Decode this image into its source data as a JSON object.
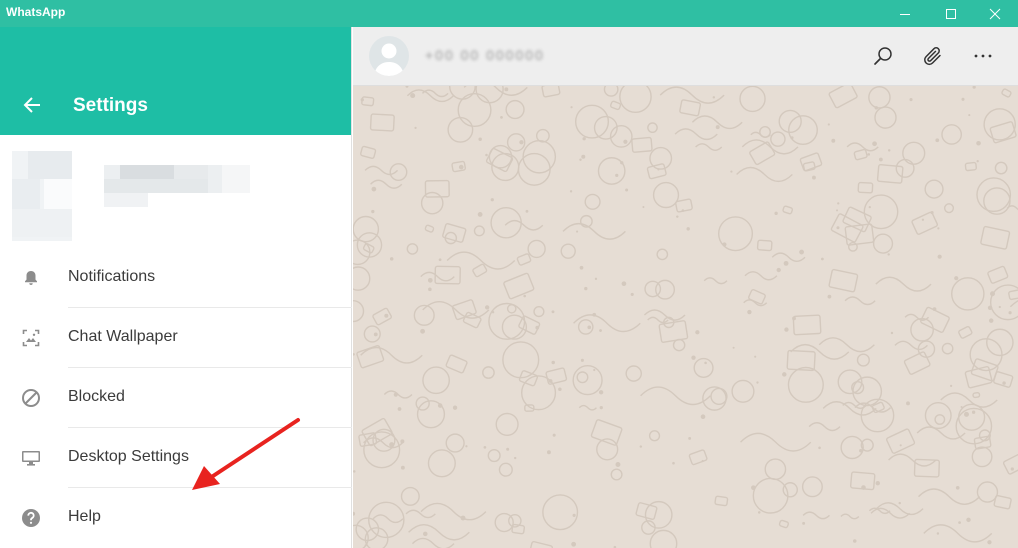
{
  "window": {
    "title": "WhatsApp",
    "controls": [
      "minimize",
      "maximize",
      "close"
    ]
  },
  "settings": {
    "title": "Settings",
    "back_icon": "arrow-left-icon",
    "menu": [
      {
        "label": "Notifications",
        "icon": "bell-icon"
      },
      {
        "label": "Chat Wallpaper",
        "icon": "wallpaper-icon"
      },
      {
        "label": "Blocked",
        "icon": "blocked-icon"
      },
      {
        "label": "Desktop Settings",
        "icon": "monitor-icon"
      },
      {
        "label": "Help",
        "icon": "help-icon"
      }
    ]
  },
  "chat": {
    "contact_name": "+00 00 000000",
    "icons": [
      "search-icon",
      "attach-icon",
      "more-icon"
    ]
  },
  "colors": {
    "titlebar": "#2fbfa3",
    "header": "#1ebea5",
    "wallpaper": "#e6ddd4",
    "annotation_arrow": "#e8231f"
  }
}
